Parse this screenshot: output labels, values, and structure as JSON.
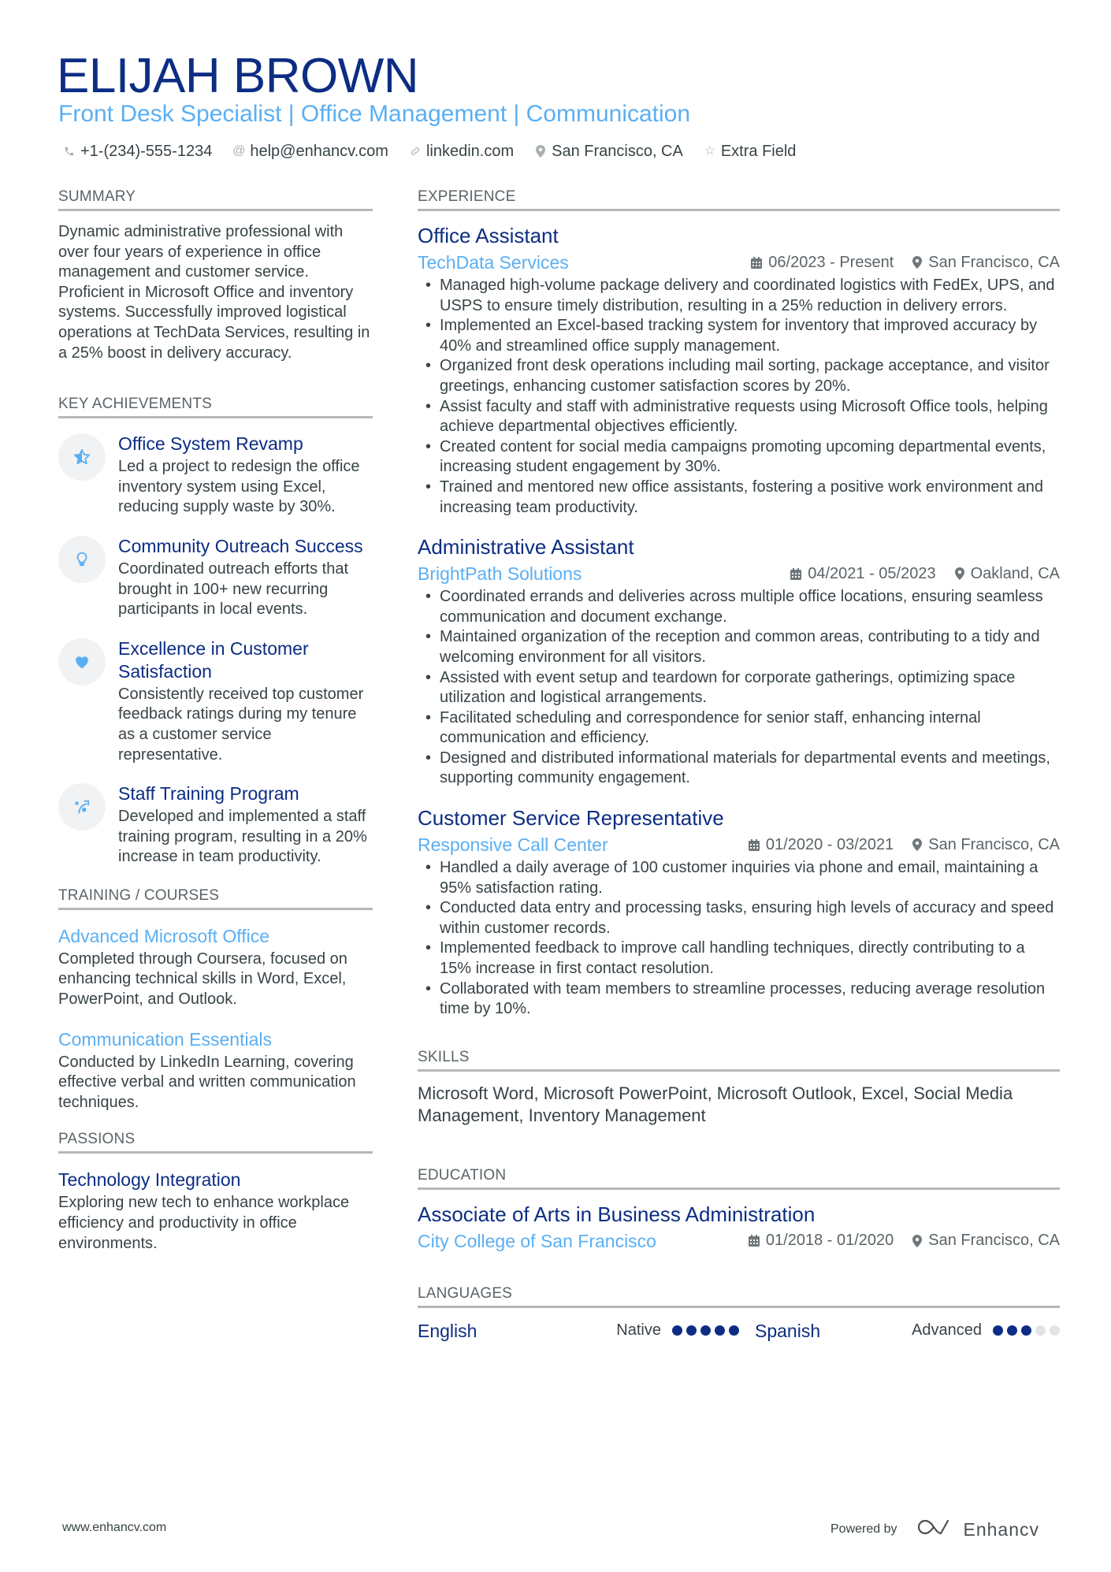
{
  "header": {
    "name": "ELIJAH BROWN",
    "subtitle": "Front Desk Specialist | Office Management | Communication",
    "contacts": [
      {
        "icon": "phone-icon",
        "text": "+1-(234)-555-1234"
      },
      {
        "icon": "at-icon",
        "text": "help@enhancv.com"
      },
      {
        "icon": "link-icon",
        "text": "linkedin.com"
      },
      {
        "icon": "location-icon",
        "text": "San Francisco, CA"
      },
      {
        "icon": "star-icon",
        "text": "Extra Field"
      }
    ]
  },
  "summary": {
    "title": "SUMMARY",
    "text": "Dynamic administrative professional with over four years of experience in office management and customer service. Proficient in Microsoft Office and inventory systems. Successfully improved logistical operations at TechData Services, resulting in a 25% boost in delivery accuracy."
  },
  "achievements": {
    "title": "KEY ACHIEVEMENTS",
    "items": [
      {
        "icon": "star-half-icon",
        "title": "Office System Revamp",
        "text": "Led a project to redesign the office inventory system using Excel, reducing supply waste by 30%."
      },
      {
        "icon": "lightbulb-icon",
        "title": "Community Outreach Success",
        "text": "Coordinated outreach efforts that brought in 100+ new recurring participants in local events."
      },
      {
        "icon": "heart-icon",
        "title": "Excellence in Customer Satisfaction",
        "text": "Consistently received top customer feedback ratings during my tenure as a customer service representative."
      },
      {
        "icon": "strategy-icon",
        "title": "Staff Training Program",
        "text": "Developed and implemented a staff training program, resulting in a 20% increase in team productivity."
      }
    ]
  },
  "training": {
    "title": "TRAINING / COURSES",
    "items": [
      {
        "title": "Advanced Microsoft Office",
        "text": "Completed through Coursera, focused on enhancing technical skills in Word, Excel, PowerPoint, and Outlook."
      },
      {
        "title": "Communication Essentials",
        "text": "Conducted by LinkedIn Learning, covering effective verbal and written communication techniques."
      }
    ]
  },
  "passions": {
    "title": "PASSIONS",
    "items": [
      {
        "title": "Technology Integration",
        "text": "Exploring new tech to enhance workplace efficiency and productivity in office environments."
      }
    ]
  },
  "experience": {
    "title": "EXPERIENCE",
    "jobs": [
      {
        "title": "Office Assistant",
        "company": "TechData Services",
        "dates": "06/2023 - Present",
        "location": "San Francisco, CA",
        "bullets": [
          "Managed high-volume package delivery and coordinated logistics with FedEx, UPS, and USPS to ensure timely distribution, resulting in a 25% reduction in delivery errors.",
          "Implemented an Excel-based tracking system for inventory that improved accuracy by 40% and streamlined office supply management.",
          "Organized front desk operations including mail sorting, package acceptance, and visitor greetings, enhancing customer satisfaction scores by 20%.",
          "Assist faculty and staff with administrative requests using Microsoft Office tools, helping achieve departmental objectives efficiently.",
          "Created content for social media campaigns promoting upcoming departmental events, increasing student engagement by 30%.",
          "Trained and mentored new office assistants, fostering a positive work environment and increasing team productivity."
        ]
      },
      {
        "title": "Administrative Assistant",
        "company": "BrightPath Solutions",
        "dates": "04/2021 - 05/2023",
        "location": "Oakland, CA",
        "bullets": [
          "Coordinated errands and deliveries across multiple office locations, ensuring seamless communication and document exchange.",
          "Maintained organization of the reception and common areas, contributing to a tidy and welcoming environment for all visitors.",
          "Assisted with event setup and teardown for corporate gatherings, optimizing space utilization and logistical arrangements.",
          "Facilitated scheduling and correspondence for senior staff, enhancing internal communication and efficiency.",
          "Designed and distributed informational materials for departmental events and meetings, supporting community engagement."
        ]
      },
      {
        "title": "Customer Service Representative",
        "company": "Responsive Call Center",
        "dates": "01/2020 - 03/2021",
        "location": "San Francisco, CA",
        "bullets": [
          "Handled a daily average of 100 customer inquiries via phone and email, maintaining a 95% satisfaction rating.",
          "Conducted data entry and processing tasks, ensuring high levels of accuracy and speed within customer records.",
          "Implemented feedback to improve call handling techniques, directly contributing to a 15% increase in first contact resolution.",
          "Collaborated with team members to streamline processes, reducing average resolution time by 10%."
        ]
      }
    ]
  },
  "skills": {
    "title": "SKILLS",
    "text": "Microsoft Word, Microsoft PowerPoint, Microsoft Outlook, Excel, Social Media Management, Inventory Management"
  },
  "education": {
    "title": "EDUCATION",
    "items": [
      {
        "degree": "Associate of Arts in Business Administration",
        "school": "City College of San Francisco",
        "dates": "01/2018 - 01/2020",
        "location": "San Francisco, CA"
      }
    ]
  },
  "languages": {
    "title": "LANGUAGES",
    "items": [
      {
        "name": "English",
        "level": "Native",
        "rating": 5,
        "max": 5
      },
      {
        "name": "Spanish",
        "level": "Advanced",
        "rating": 3,
        "max": 5
      }
    ]
  },
  "footer": {
    "website": "www.enhancv.com",
    "powered_by": "Powered by",
    "brand": "Enhancv"
  },
  "colors": {
    "primary": "#0c2d83",
    "accent": "#5aaff3",
    "text": "#384347",
    "rule": "#b5b8ba"
  }
}
